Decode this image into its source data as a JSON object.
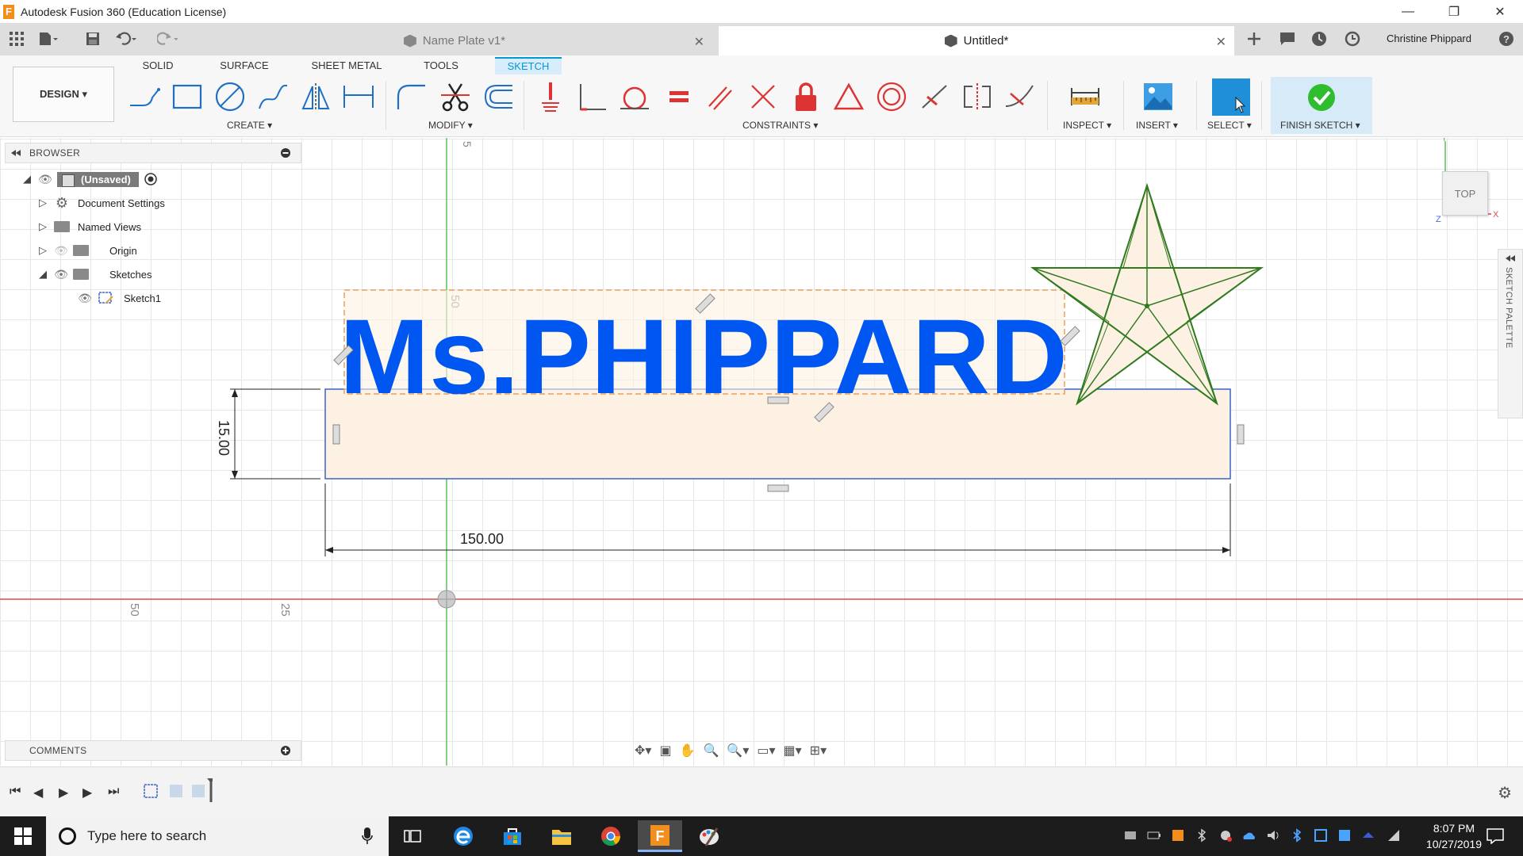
{
  "window": {
    "title": "Autodesk Fusion 360 (Education License)",
    "logo_letter": "F",
    "minimize_glyph": "—",
    "maximize_glyph": "❐",
    "close_glyph": "✕"
  },
  "tabs": [
    {
      "label": "Name Plate v1*",
      "active": false
    },
    {
      "label": "Untitled*",
      "active": true
    }
  ],
  "tab_close_glyph": "✕",
  "user": {
    "name": "Christine Phippard"
  },
  "toolbar": {
    "workspace_tabs": [
      "SOLID",
      "SURFACE",
      "SHEET METAL",
      "TOOLS",
      "SKETCH"
    ],
    "active_tab": "SKETCH",
    "design_label": "DESIGN ▾",
    "groups": {
      "create": "CREATE ▾",
      "modify": "MODIFY ▾",
      "constraints": "CONSTRAINTS ▾",
      "inspect": "INSPECT ▾",
      "insert": "INSERT ▾",
      "select": "SELECT ▾",
      "finish": "FINISH SKETCH ▾"
    },
    "colors": {
      "accent": "#0696d7",
      "select": "#1e8fd8",
      "finish_check": "#2ebd2e",
      "constraint": "#d33333"
    }
  },
  "browser": {
    "title": "BROWSER",
    "root": "(Unsaved)",
    "items": [
      {
        "label": "Document Settings",
        "icon": "gear-icon"
      },
      {
        "label": "Named Views",
        "icon": "folder-icon"
      },
      {
        "label": "Origin",
        "icon": "folder-icon"
      },
      {
        "label": "Sketches",
        "icon": "folder-icon"
      },
      {
        "label": "Sketch1",
        "icon": "sketch-icon"
      }
    ]
  },
  "comments": {
    "title": "COMMENTS"
  },
  "canvas": {
    "sketch_text": "Ms.PHIPPARD",
    "dimension_height": "15.00",
    "dimension_width": "150.00",
    "ruler_labels": {
      "top": "5",
      "v50": "50",
      "v25": "25",
      "h50": "50",
      "h25": "25"
    },
    "text_color": "#0056f0",
    "star_color": "#2f7a1f",
    "axis_red": "#e24a4a",
    "axis_green": "#5cc15c"
  },
  "viewcube": {
    "label": "TOP",
    "axis_x": "X",
    "axis_y": "Y",
    "axis_z": "Z"
  },
  "sketch_palette": {
    "label": "SKETCH PALETTE"
  },
  "taskbar": {
    "search_placeholder": "Type here to search",
    "time": "8:07 PM",
    "date": "10/27/2019"
  }
}
